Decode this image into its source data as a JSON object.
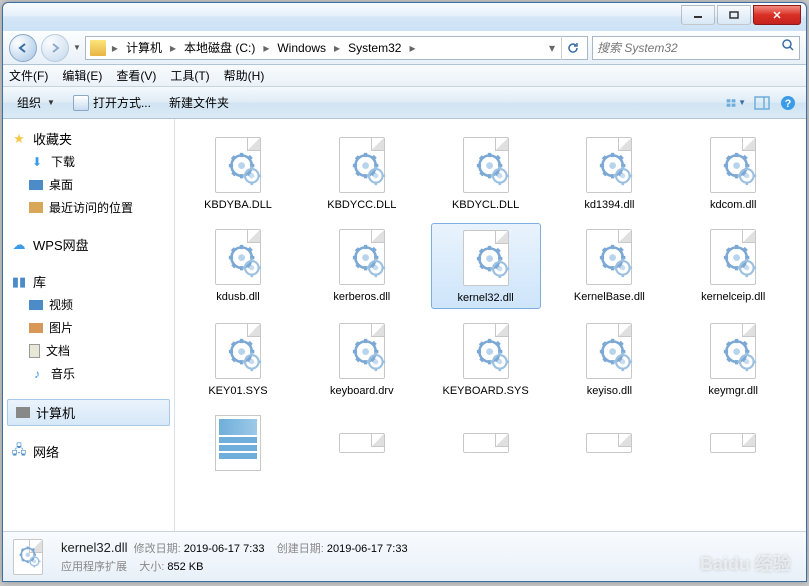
{
  "breadcrumb": {
    "items": [
      "计算机",
      "本地磁盘 (C:)",
      "Windows",
      "System32"
    ]
  },
  "search": {
    "placeholder": "搜索 System32"
  },
  "menu": {
    "file": "文件(F)",
    "edit": "编辑(E)",
    "view": "查看(V)",
    "tools": "工具(T)",
    "help": "帮助(H)"
  },
  "toolbar": {
    "organize": "组织",
    "openWith": "打开方式...",
    "newFolder": "新建文件夹"
  },
  "sidebar": {
    "favorites": "收藏夹",
    "downloads": "下载",
    "desktop": "桌面",
    "recent": "最近访问的位置",
    "wps": "WPS网盘",
    "libraries": "库",
    "videos": "视频",
    "pictures": "图片",
    "documents": "文档",
    "music": "音乐",
    "computer": "计算机",
    "network": "网络"
  },
  "files": [
    {
      "name": "KBDYBA.DLL",
      "sel": false
    },
    {
      "name": "KBDYCC.DLL",
      "sel": false
    },
    {
      "name": "KBDYCL.DLL",
      "sel": false
    },
    {
      "name": "kd1394.dll",
      "sel": false
    },
    {
      "name": "kdcom.dll",
      "sel": false
    },
    {
      "name": "kdusb.dll",
      "sel": false
    },
    {
      "name": "kerberos.dll",
      "sel": false
    },
    {
      "name": "kernel32.dll",
      "sel": true
    },
    {
      "name": "KernelBase.dll",
      "sel": false
    },
    {
      "name": "kernelceip.dll",
      "sel": false
    },
    {
      "name": "KEY01.SYS",
      "sel": false
    },
    {
      "name": "keyboard.drv",
      "sel": false
    },
    {
      "name": "KEYBOARD.SYS",
      "sel": false
    },
    {
      "name": "keyiso.dll",
      "sel": false
    },
    {
      "name": "keymgr.dll",
      "sel": false
    }
  ],
  "details": {
    "name": "kernel32.dll",
    "type": "应用程序扩展",
    "modLabel": "修改日期:",
    "modDate": "2019-06-17 7:33",
    "createLabel": "创建日期:",
    "createDate": "2019-06-17 7:33",
    "sizeLabel": "大小:",
    "size": "852 KB"
  },
  "watermark": "Baidu 经验"
}
